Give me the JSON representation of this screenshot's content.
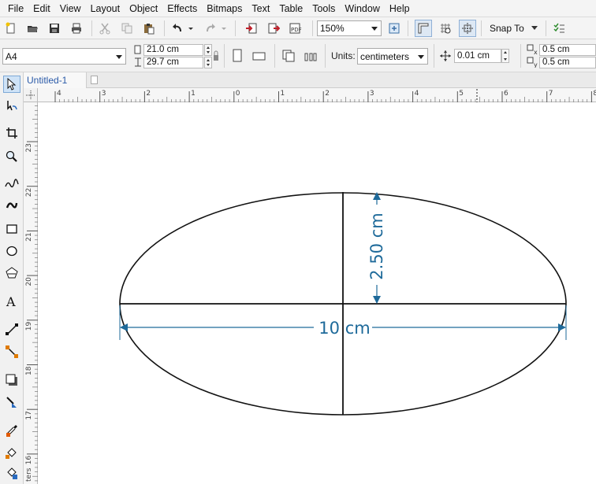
{
  "menu": [
    "File",
    "Edit",
    "View",
    "Layout",
    "Object",
    "Effects",
    "Bitmaps",
    "Text",
    "Table",
    "Tools",
    "Window",
    "Help"
  ],
  "toolbar": {
    "zoom_value": "150%",
    "snap_label": "Snap To"
  },
  "property_bar": {
    "page_size": "A4",
    "width": "21.0 cm",
    "height": "29.7 cm",
    "units_label": "Units:",
    "units_value": "centimeters",
    "nudge": "0.01 cm",
    "dup_x": "0.5 cm",
    "dup_y": "0.5 cm"
  },
  "tabs": {
    "document": "Untitled-1"
  },
  "ruler": {
    "h_labels": [
      "4",
      "3",
      "2",
      "1",
      "0",
      "1",
      "2",
      "3",
      "4",
      "5",
      "6",
      "7",
      "8"
    ],
    "v_labels": [
      "23",
      "22",
      "21",
      "20",
      "19",
      "18",
      "17",
      "16"
    ],
    "v_unit": "ters"
  },
  "drawing": {
    "width_dim": "10 cm",
    "height_dim": "2.50 cm",
    "dim_color": "#1e6a9a",
    "stroke_color": "#111111"
  },
  "icons": {
    "toolbox": [
      "pick-tool-icon",
      "shape-tool-icon",
      "crop-tool-icon",
      "zoom-tool-icon",
      "freehand-tool-icon",
      "artistic-media-icon",
      "rectangle-tool-icon",
      "ellipse-tool-icon",
      "polygon-tool-icon",
      "text-tool-icon",
      "dimension-tool-icon",
      "connector-tool-icon",
      "shadow-tool-icon",
      "transparency-tool-icon",
      "eyedropper-tool-icon",
      "fill-tool-icon",
      "smart-fill-tool-icon"
    ]
  }
}
